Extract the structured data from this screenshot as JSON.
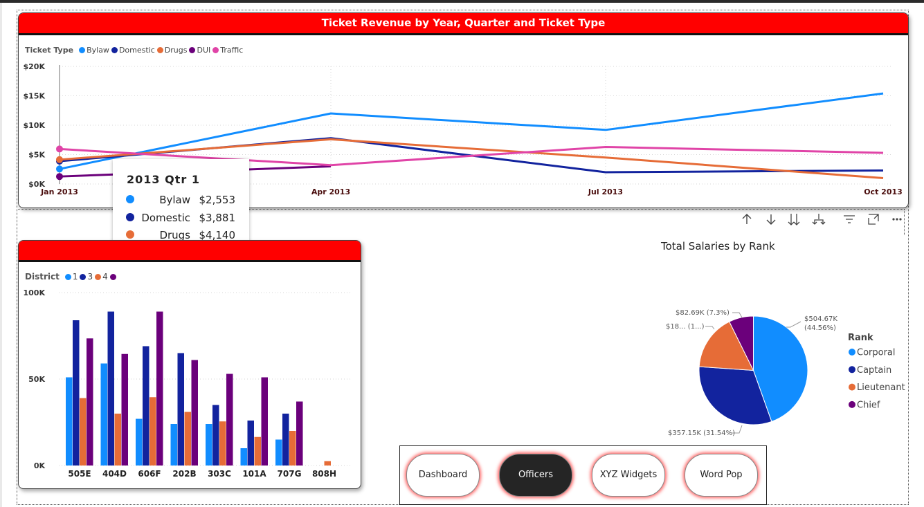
{
  "line_card": {
    "title": "Ticket Revenue by Year, Quarter and Ticket Type",
    "legend_label": "Ticket Type"
  },
  "bar_card": {
    "legend_label": "District"
  },
  "tooltip": {
    "title": "2013 Qtr 1",
    "rows": [
      {
        "name": "Bylaw",
        "value": "$2,553",
        "color": "#118DFF"
      },
      {
        "name": "Domestic",
        "value": "$3,881",
        "color": "#12239E"
      },
      {
        "name": "Drugs",
        "value": "$4,140",
        "color": "#E66C37"
      },
      {
        "name": "DUI",
        "value": "$1,272",
        "color": "#6B007B"
      },
      {
        "name": "Traffic",
        "value": "$5,950",
        "color": "#E044A7"
      }
    ]
  },
  "toolbar": {
    "icons": [
      "arrow-up-icon",
      "arrow-down-icon",
      "double-arrow-down-icon",
      "expand-hierarchy-icon",
      "filter-icon",
      "focus-mode-icon",
      "more-options-icon"
    ]
  },
  "pie_card": {
    "title": "Total Salaries by Rank"
  },
  "nav": {
    "buttons": [
      "Dashboard",
      "Officers",
      "XYZ Widgets",
      "Word Pop"
    ],
    "active": "Officers"
  },
  "chart_data": [
    {
      "type": "line",
      "title": "Ticket Revenue by Year, Quarter and Ticket Type",
      "x": [
        "Jan 2013",
        "Apr 2013",
        "Jul 2013",
        "Oct 2013"
      ],
      "y_ticks": [
        "$0K",
        "$5K",
        "$10K",
        "$15K",
        "$20K"
      ],
      "ylim": [
        0,
        20000
      ],
      "legend_title": "Ticket Type",
      "legend_placement": "top-left",
      "grid": true,
      "series": [
        {
          "name": "Bylaw",
          "color": "#118DFF",
          "values": [
            2553,
            12000,
            9200,
            15400
          ]
        },
        {
          "name": "Domestic",
          "color": "#12239E",
          "values": [
            3881,
            7800,
            2000,
            2300
          ]
        },
        {
          "name": "Drugs",
          "color": "#E66C37",
          "values": [
            4140,
            7600,
            4500,
            1000
          ]
        },
        {
          "name": "DUI",
          "color": "#6B007B",
          "values": [
            1272,
            3000,
            null,
            null
          ]
        },
        {
          "name": "Traffic",
          "color": "#E044A7",
          "values": [
            5950,
            3200,
            6300,
            5300
          ]
        }
      ]
    },
    {
      "type": "bar",
      "categories": [
        "505E",
        "404D",
        "606F",
        "202B",
        "303C",
        "101A",
        "707G",
        "808H"
      ],
      "y_ticks": [
        "0K",
        "50K",
        "100K"
      ],
      "ylim": [
        0,
        100000
      ],
      "legend_title": "District",
      "legend_placement": "top-left",
      "grid": true,
      "series": [
        {
          "name": "1",
          "color": "#118DFF",
          "values": [
            51000,
            59000,
            27000,
            24000,
            24000,
            10000,
            15000,
            0
          ]
        },
        {
          "name": "3",
          "color": "#12239E",
          "values": [
            84000,
            89000,
            69000,
            65000,
            35000,
            26000,
            30000,
            0
          ]
        },
        {
          "name": "4",
          "color": "#E66C37",
          "values": [
            39000,
            30000,
            39500,
            31000,
            25500,
            16500,
            20000,
            2500
          ]
        },
        {
          "color": "#6B007B",
          "values": [
            73500,
            64500,
            89000,
            61000,
            53000,
            51000,
            37000,
            0
          ]
        }
      ]
    },
    {
      "type": "pie",
      "title": "Total Salaries by Rank",
      "legend_title": "Rank",
      "legend_placement": "right",
      "slices": [
        {
          "name": "Corporal",
          "value": 504.67,
          "percent": 44.56,
          "color": "#118DFF",
          "label": "$504.67K (44.56%)"
        },
        {
          "name": "Captain",
          "value": 357.15,
          "percent": 31.54,
          "color": "#12239E",
          "label": "$357.15K (31.54%)"
        },
        {
          "name": "Lieutenant",
          "value": 188.1,
          "percent": 16.6,
          "color": "#E66C37",
          "label": "$18... (1...)"
        },
        {
          "name": "Chief",
          "value": 82.69,
          "percent": 7.3,
          "color": "#6B007B",
          "label": "$82.69K (7.3%)"
        }
      ]
    }
  ]
}
